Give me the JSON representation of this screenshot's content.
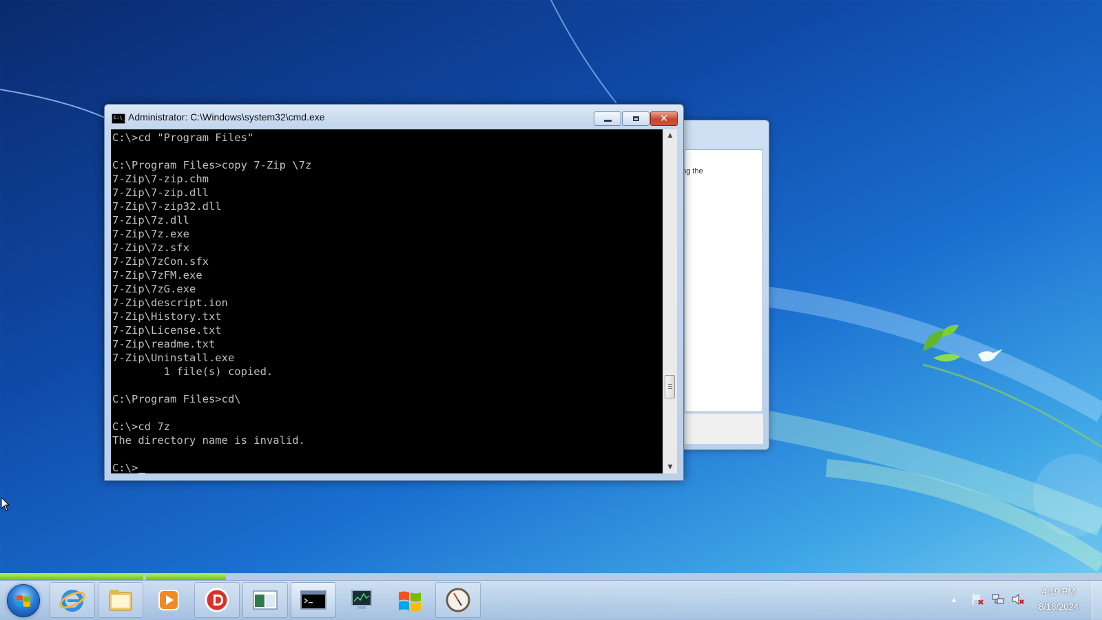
{
  "background_dialog": {
    "snippet": "ring the"
  },
  "console": {
    "title": "Administrator: C:\\Windows\\system32\\cmd.exe",
    "lines": [
      "C:\\>cd \"Program Files\"",
      "",
      "C:\\Program Files>copy 7-Zip \\7z",
      "7-Zip\\7-zip.chm",
      "7-Zip\\7-zip.dll",
      "7-Zip\\7-zip32.dll",
      "7-Zip\\7z.dll",
      "7-Zip\\7z.exe",
      "7-Zip\\7z.sfx",
      "7-Zip\\7zCon.sfx",
      "7-Zip\\7zFM.exe",
      "7-Zip\\7zG.exe",
      "7-Zip\\descript.ion",
      "7-Zip\\History.txt",
      "7-Zip\\License.txt",
      "7-Zip\\readme.txt",
      "7-Zip\\Uninstall.exe",
      "        1 file(s) copied.",
      "",
      "C:\\Program Files>cd\\",
      "",
      "C:\\>cd 7z",
      "The directory name is invalid.",
      "",
      "C:\\>"
    ],
    "title_icon_text": "C:\\_",
    "close_glyph": "✕"
  },
  "taskbar": {
    "pinned": [
      {
        "name": "internet-explorer-icon"
      },
      {
        "name": "file-explorer-icon"
      },
      {
        "name": "media-player-icon"
      },
      {
        "name": "d-app-icon"
      },
      {
        "name": "panel-window-icon"
      },
      {
        "name": "command-prompt-icon"
      },
      {
        "name": "task-manager-icon"
      },
      {
        "name": "windows-update-icon"
      },
      {
        "name": "clock-app-icon"
      }
    ],
    "progress": [
      1.0,
      1.0
    ],
    "clock": {
      "time": "4:19 PM",
      "date": "8/18/2024"
    },
    "tray_expand": "▲"
  },
  "colors": {
    "console_bg": "#000000",
    "console_text": "#c0c0c0",
    "accent": "#1a6fd0"
  }
}
